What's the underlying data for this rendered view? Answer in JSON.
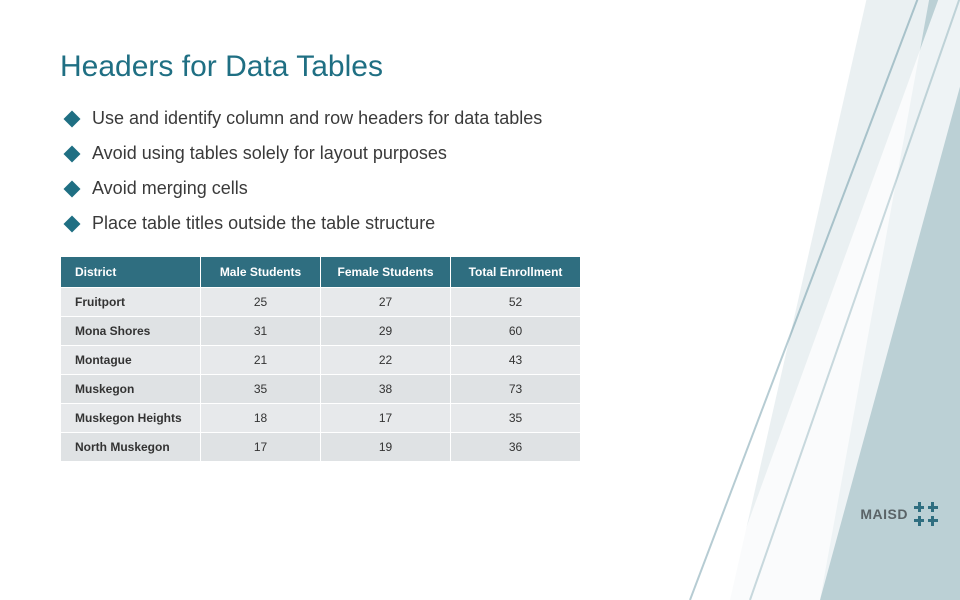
{
  "title": "Headers for Data Tables",
  "bullets": [
    "Use and identify column and row headers for data tables",
    "Avoid using tables solely for layout purposes",
    "Avoid merging cells",
    "Place table titles outside the table structure"
  ],
  "table": {
    "headers": [
      "District",
      "Male Students",
      "Female Students",
      "Total Enrollment"
    ],
    "rows": [
      {
        "district": "Fruitport",
        "male": 25,
        "female": 27,
        "total": 52
      },
      {
        "district": "Mona Shores",
        "male": 31,
        "female": 29,
        "total": 60
      },
      {
        "district": "Montague",
        "male": 21,
        "female": 22,
        "total": 43
      },
      {
        "district": "Muskegon",
        "male": 35,
        "female": 38,
        "total": 73
      },
      {
        "district": "Muskegon Heights",
        "male": 18,
        "female": 17,
        "total": 35
      },
      {
        "district": "North Muskegon",
        "male": 17,
        "female": 19,
        "total": 36
      }
    ]
  },
  "logo_text": "MAISD"
}
